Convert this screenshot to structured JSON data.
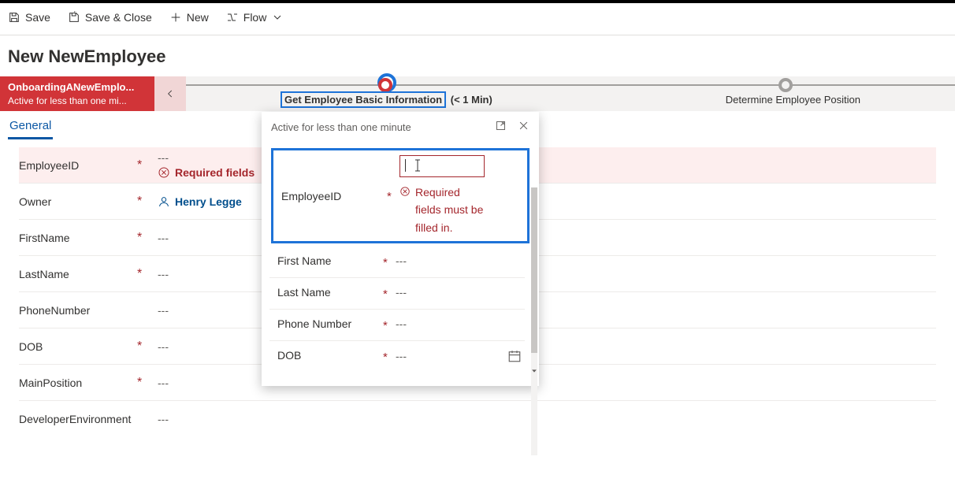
{
  "cmdbar": {
    "save": "Save",
    "save_close": "Save & Close",
    "new": "New",
    "flow": "Flow"
  },
  "page_title": "New NewEmployee",
  "bpf": {
    "stage1_title": "OnboardingANewEmplo...",
    "stage1_sub": "Active for less than one mi...",
    "stage2_label_a": "Get Employee Basic Information",
    "stage2_label_b": "(< 1 Min)",
    "stage3_label": "Determine Employee Position"
  },
  "tabs": {
    "general": "General"
  },
  "form": {
    "employee_id": {
      "label": "EmployeeID",
      "value": "---",
      "error": "Required fields"
    },
    "owner": {
      "label": "Owner",
      "value": "Henry Legge"
    },
    "first_name": {
      "label": "FirstName",
      "value": "---"
    },
    "last_name": {
      "label": "LastName",
      "value": "---"
    },
    "phone": {
      "label": "PhoneNumber",
      "value": "---"
    },
    "dob": {
      "label": "DOB",
      "value": "---"
    },
    "main_position": {
      "label": "MainPosition",
      "value": "---"
    },
    "dev_env": {
      "label": "DeveloperEnvironment",
      "value": "---"
    }
  },
  "flyout": {
    "status": "Active for less than one minute",
    "employee_id_label": "EmployeeID",
    "employee_id_error": "Required fields must be filled in.",
    "first_name": {
      "label": "First Name",
      "value": "---"
    },
    "last_name": {
      "label": "Last Name",
      "value": "---"
    },
    "phone": {
      "label": "Phone Number",
      "value": "---"
    },
    "dob": {
      "label": "DOB",
      "value": "---"
    }
  },
  "required_marker": "*"
}
